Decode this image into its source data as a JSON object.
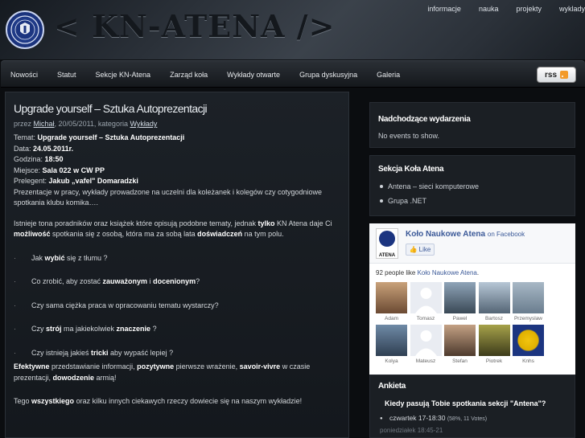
{
  "header": {
    "title": "< KN-ATENA />",
    "top_nav": [
      "informacje",
      "nauka",
      "projekty",
      "wyklady"
    ]
  },
  "navbar": {
    "items": [
      "Nowości",
      "Statut",
      "Sekcje KN-Atena",
      "Zarząd koła",
      "Wykłady otwarte",
      "Grupa dyskusyjna",
      "Galeria"
    ],
    "rss_label": "rss"
  },
  "post": {
    "title": "Upgrade yourself – Sztuka Autoprezentacji",
    "meta_prefix": "przez",
    "author": "Michał",
    "meta_mid": ", 20/05/2011, kategoria",
    "category": "Wykłady",
    "temat_label": "Temat:",
    "temat": "Upgrade yourself – Sztuka Autoprezentacji",
    "data_label": "Data:",
    "data": "24.05.2011r.",
    "godzina_label": "Godzina:",
    "godzina": "18:50",
    "miejsce_label": "Miejsce:",
    "miejsce": "Sala 022 w CW PP",
    "prelegent_label": "Prelegent:",
    "prelegent": "Jakub „vafel\" Domaradzki",
    "desc1": "Prezentacje w pracy, wykłady prowadzone na uczelni dla koleżanek i kolegów czy cotygodniowe",
    "desc2": "spotkania klubu komika….",
    "p1_a": "Istnieje tona poradników oraz książek które opisują podobne tematy, jednak ",
    "p1_b": "tylko",
    "p1_c": " KN Atena daje Ci",
    "p1_d": "możliwość",
    "p1_e": " spotkania się z osobą, która ma za sobą lata ",
    "p1_f": "doświadczeń",
    "p1_g": " na tym polu.",
    "b1_a": "Jak ",
    "b1_b": "wybić",
    "b1_c": " się z tłumu ?",
    "b2_a": "Co zrobić, aby zostać ",
    "b2_b": "zauważonym",
    "b2_c": " i ",
    "b2_d": "docenionym",
    "b2_e": "?",
    "b3": "Czy sama ciężka praca w opracowaniu tematu wystarczy?",
    "b4_a": "Czy ",
    "b4_b": "strój",
    "b4_c": " ma jakiekolwiek ",
    "b4_d": "znaczenie",
    "b4_e": " ?",
    "b5_a": "Czy istnieją jakieś ",
    "b5_b": "tricki",
    "b5_c": " aby wypaść lepiej ?",
    "p2_a": "Efektywne",
    "p2_b": " przedstawianie informacji, ",
    "p2_c": "pozytywne",
    "p2_d": " pierwsze wrażenie, ",
    "p2_e": "savoir-vivre",
    "p2_f": " w czasie",
    "p2_g": "prezentacji, ",
    "p2_h": "dowodzenie",
    "p2_i": " armią!",
    "p3_a": "Tego ",
    "p3_b": "wszystkiego",
    "p3_c": " oraz kilku innych ciekawych rzeczy dowiecie się na naszym wykładzie!"
  },
  "sidebar": {
    "events_title": "Nadchodzące wydarzenia",
    "events_text": "No events to show.",
    "sekcja_title": "Sekcja Koła Atena",
    "sekcja_items": [
      "Antena – sieci komputerowe",
      "Grupa .NET"
    ]
  },
  "facebook": {
    "logo_text": "ATENA",
    "page_name": "Koło Naukowe Atena",
    "on_facebook": "on Facebook",
    "like_label": "Like",
    "count_prefix": "92 people like ",
    "count_page": "Koło Naukowe Atena",
    "count_suffix": ".",
    "fans": [
      "Adam",
      "Tomasz",
      "Pawel",
      "Bartosz",
      "Przemyslaw",
      "Kolya",
      "Mateusz",
      "Stefan",
      "Piotrek",
      "Knhs"
    ]
  },
  "poll": {
    "title": "Ankieta",
    "question": "Kiedy pasują Tobie spotkania sekcji \"Antena\"?",
    "answer1": "czwartek 17-18:30",
    "answer1_stats": "(58%, 11 Votes)",
    "answer2": "poniedziałek 18:45-21"
  },
  "colors": {
    "background": "#0b0d10",
    "panel": "#1b1f24",
    "facebook_blue": "#3b5998"
  }
}
